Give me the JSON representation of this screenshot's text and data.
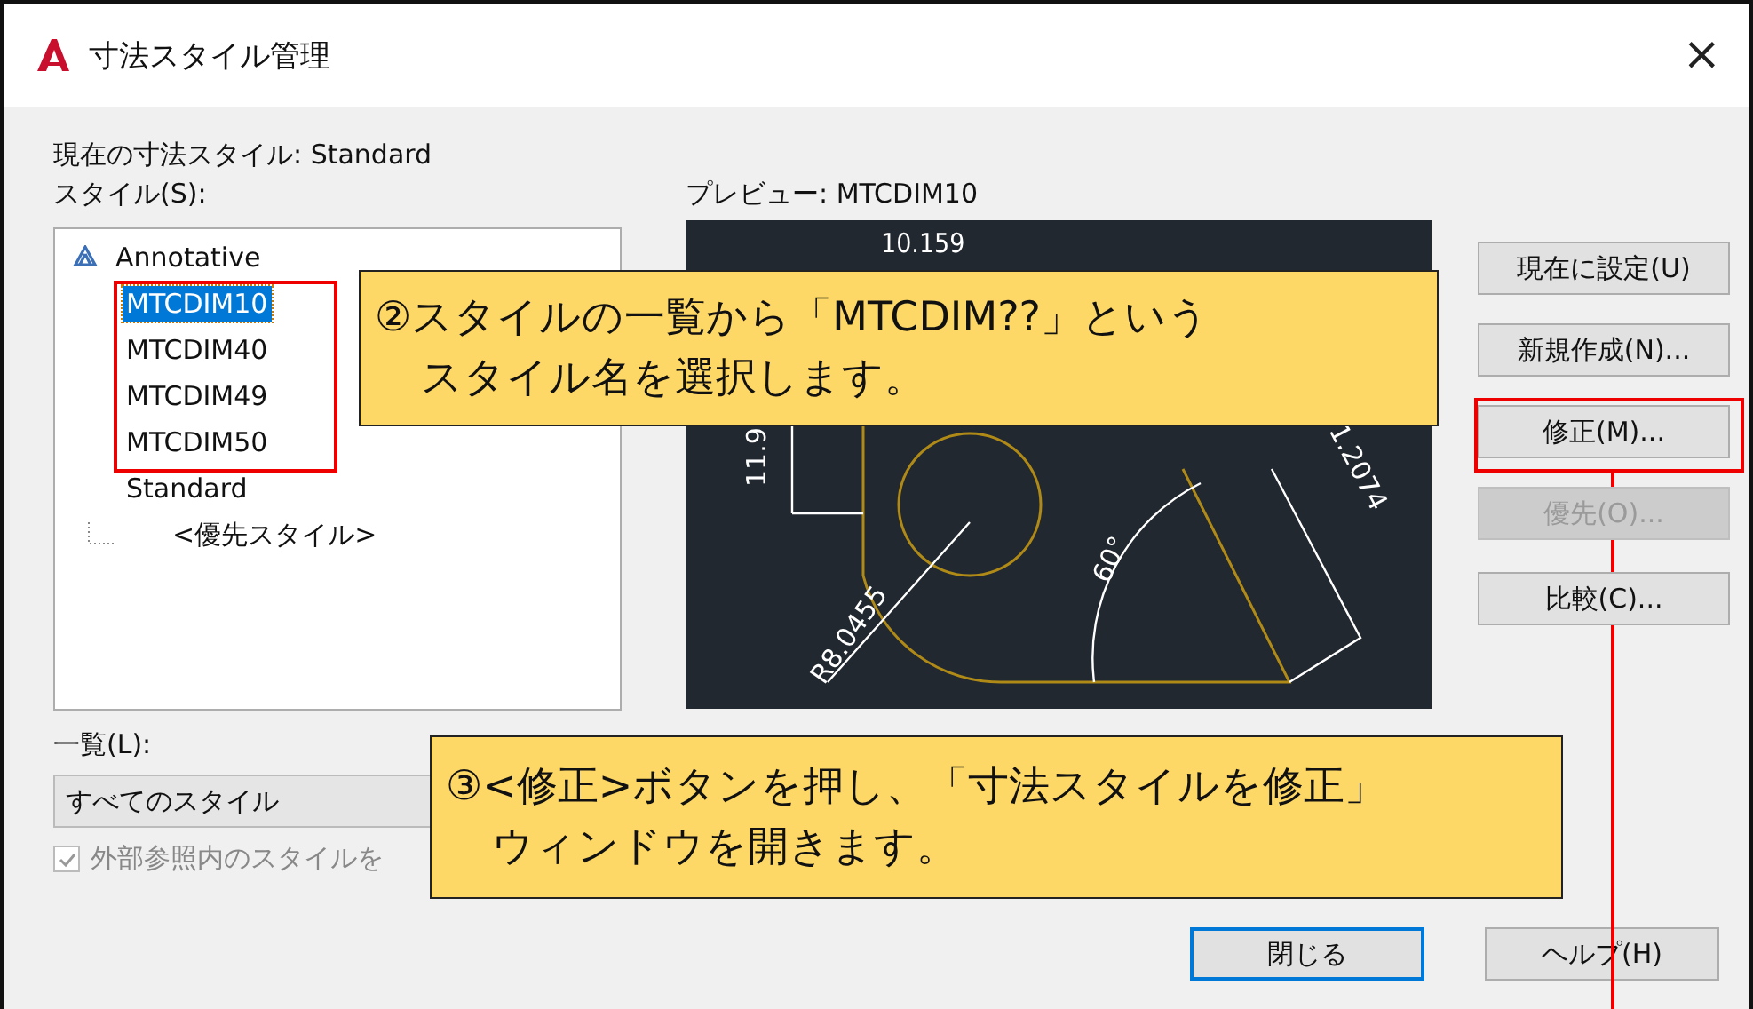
{
  "window": {
    "title": "寸法スタイル管理",
    "close": "×"
  },
  "current_style": "現在の寸法スタイル: Standard",
  "styles_label": "スタイル(S):",
  "styles": [
    {
      "label": "Annotative",
      "kind": "annotative",
      "selected": false
    },
    {
      "label": "MTCDIM10",
      "kind": "style",
      "selected": true
    },
    {
      "label": "MTCDIM40",
      "kind": "style",
      "selected": false
    },
    {
      "label": "MTCDIM49",
      "kind": "style",
      "selected": false
    },
    {
      "label": "MTCDIM50",
      "kind": "style",
      "selected": false
    },
    {
      "label": "Standard",
      "kind": "style",
      "selected": false
    },
    {
      "label": "<優先スタイル>",
      "kind": "override",
      "selected": false
    }
  ],
  "preview": {
    "label": "プレビュー: MTCDIM10",
    "dims": [
      "10.159",
      "11.9",
      "60°",
      "R8.0455",
      "1.2074"
    ]
  },
  "list_label": "一覧(L):",
  "list_value": "すべてのスタイル",
  "xref_checkbox": {
    "label": "外部参照内のスタイルを",
    "checked": true,
    "disabled": true
  },
  "side_buttons": [
    {
      "label": "現在に設定(U)",
      "disabled": false
    },
    {
      "label": "新規作成(N)...",
      "disabled": false
    },
    {
      "label": "修正(M)...",
      "disabled": false
    },
    {
      "label": "優先(O)...",
      "disabled": true
    },
    {
      "label": "比較(C)...",
      "disabled": false
    }
  ],
  "bottom_buttons": [
    {
      "label": "閉じる",
      "default": true
    },
    {
      "label": "ヘルプ(H)",
      "default": false
    }
  ],
  "callouts": [
    {
      "lines": [
        "②スタイルの一覧から「MTCDIM??」という",
        "スタイル名を選択します。"
      ]
    },
    {
      "lines": [
        "③<修正>ボタンを押し、「寸法スタイルを修正」",
        "ウィンドウを開きます。"
      ]
    }
  ]
}
